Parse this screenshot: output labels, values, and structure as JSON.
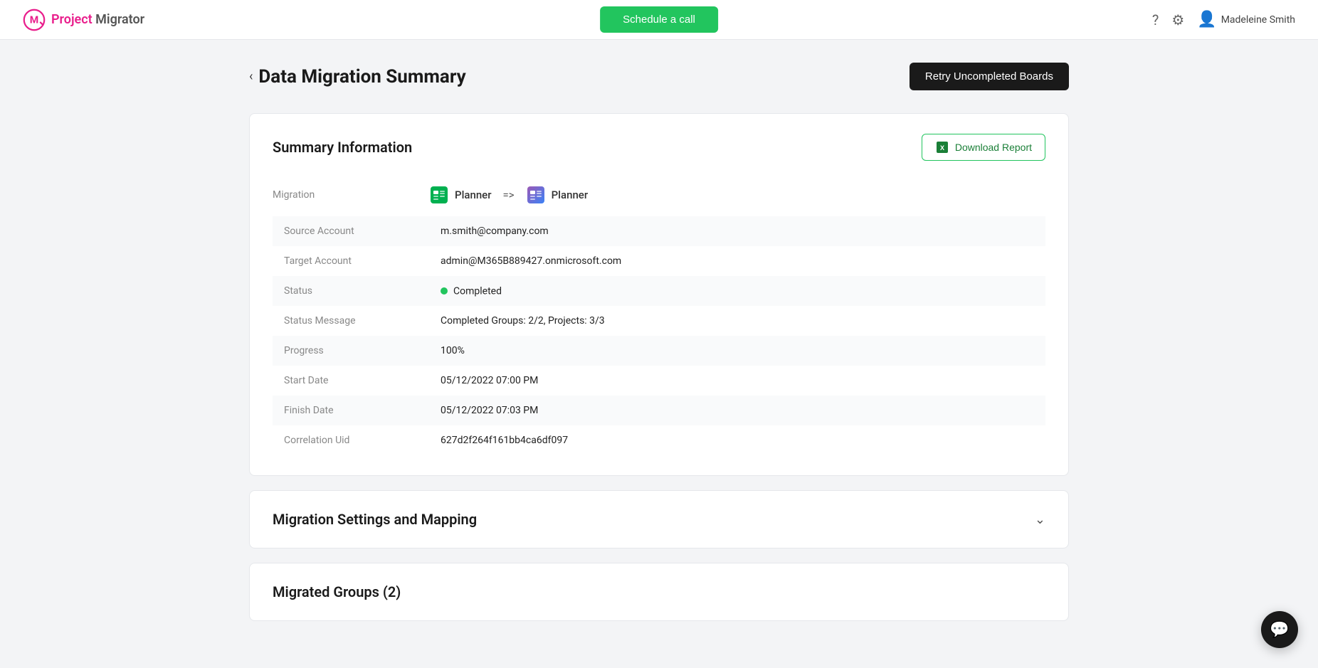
{
  "header": {
    "logo_project": "Project",
    "logo_migrator": " Migrator",
    "schedule_call": "Schedule a call",
    "help_icon": "?",
    "settings_icon": "⚙",
    "user_name": "Madeleine Smith"
  },
  "page": {
    "back_label": "‹",
    "title": "Data Migration Summary",
    "retry_button": "Retry Uncompleted Boards"
  },
  "summary_card": {
    "title": "Summary Information",
    "download_button": "Download Report",
    "migration_label": "Migration",
    "source_app": "Planner",
    "arrow": "=>",
    "target_app": "Planner",
    "rows": [
      {
        "label": "Source Account",
        "value": "m.smith@company.com"
      },
      {
        "label": "Target Account",
        "value": "admin@M365B889427.onmicrosoft.com"
      },
      {
        "label": "Status",
        "value": "Completed",
        "type": "status"
      },
      {
        "label": "Status Message",
        "value": "Completed Groups: 2/2, Projects: 3/3"
      },
      {
        "label": "Progress",
        "value": "100%"
      },
      {
        "label": "Start Date",
        "value": "05/12/2022 07:00 PM"
      },
      {
        "label": "Finish Date",
        "value": "05/12/2022 07:03 PM"
      },
      {
        "label": "Correlation Uid",
        "value": "627d2f264f161bb4ca6df097"
      }
    ]
  },
  "settings_card": {
    "title": "Migration Settings and Mapping"
  },
  "migrated_groups_card": {
    "title": "Migrated Groups (2)"
  }
}
